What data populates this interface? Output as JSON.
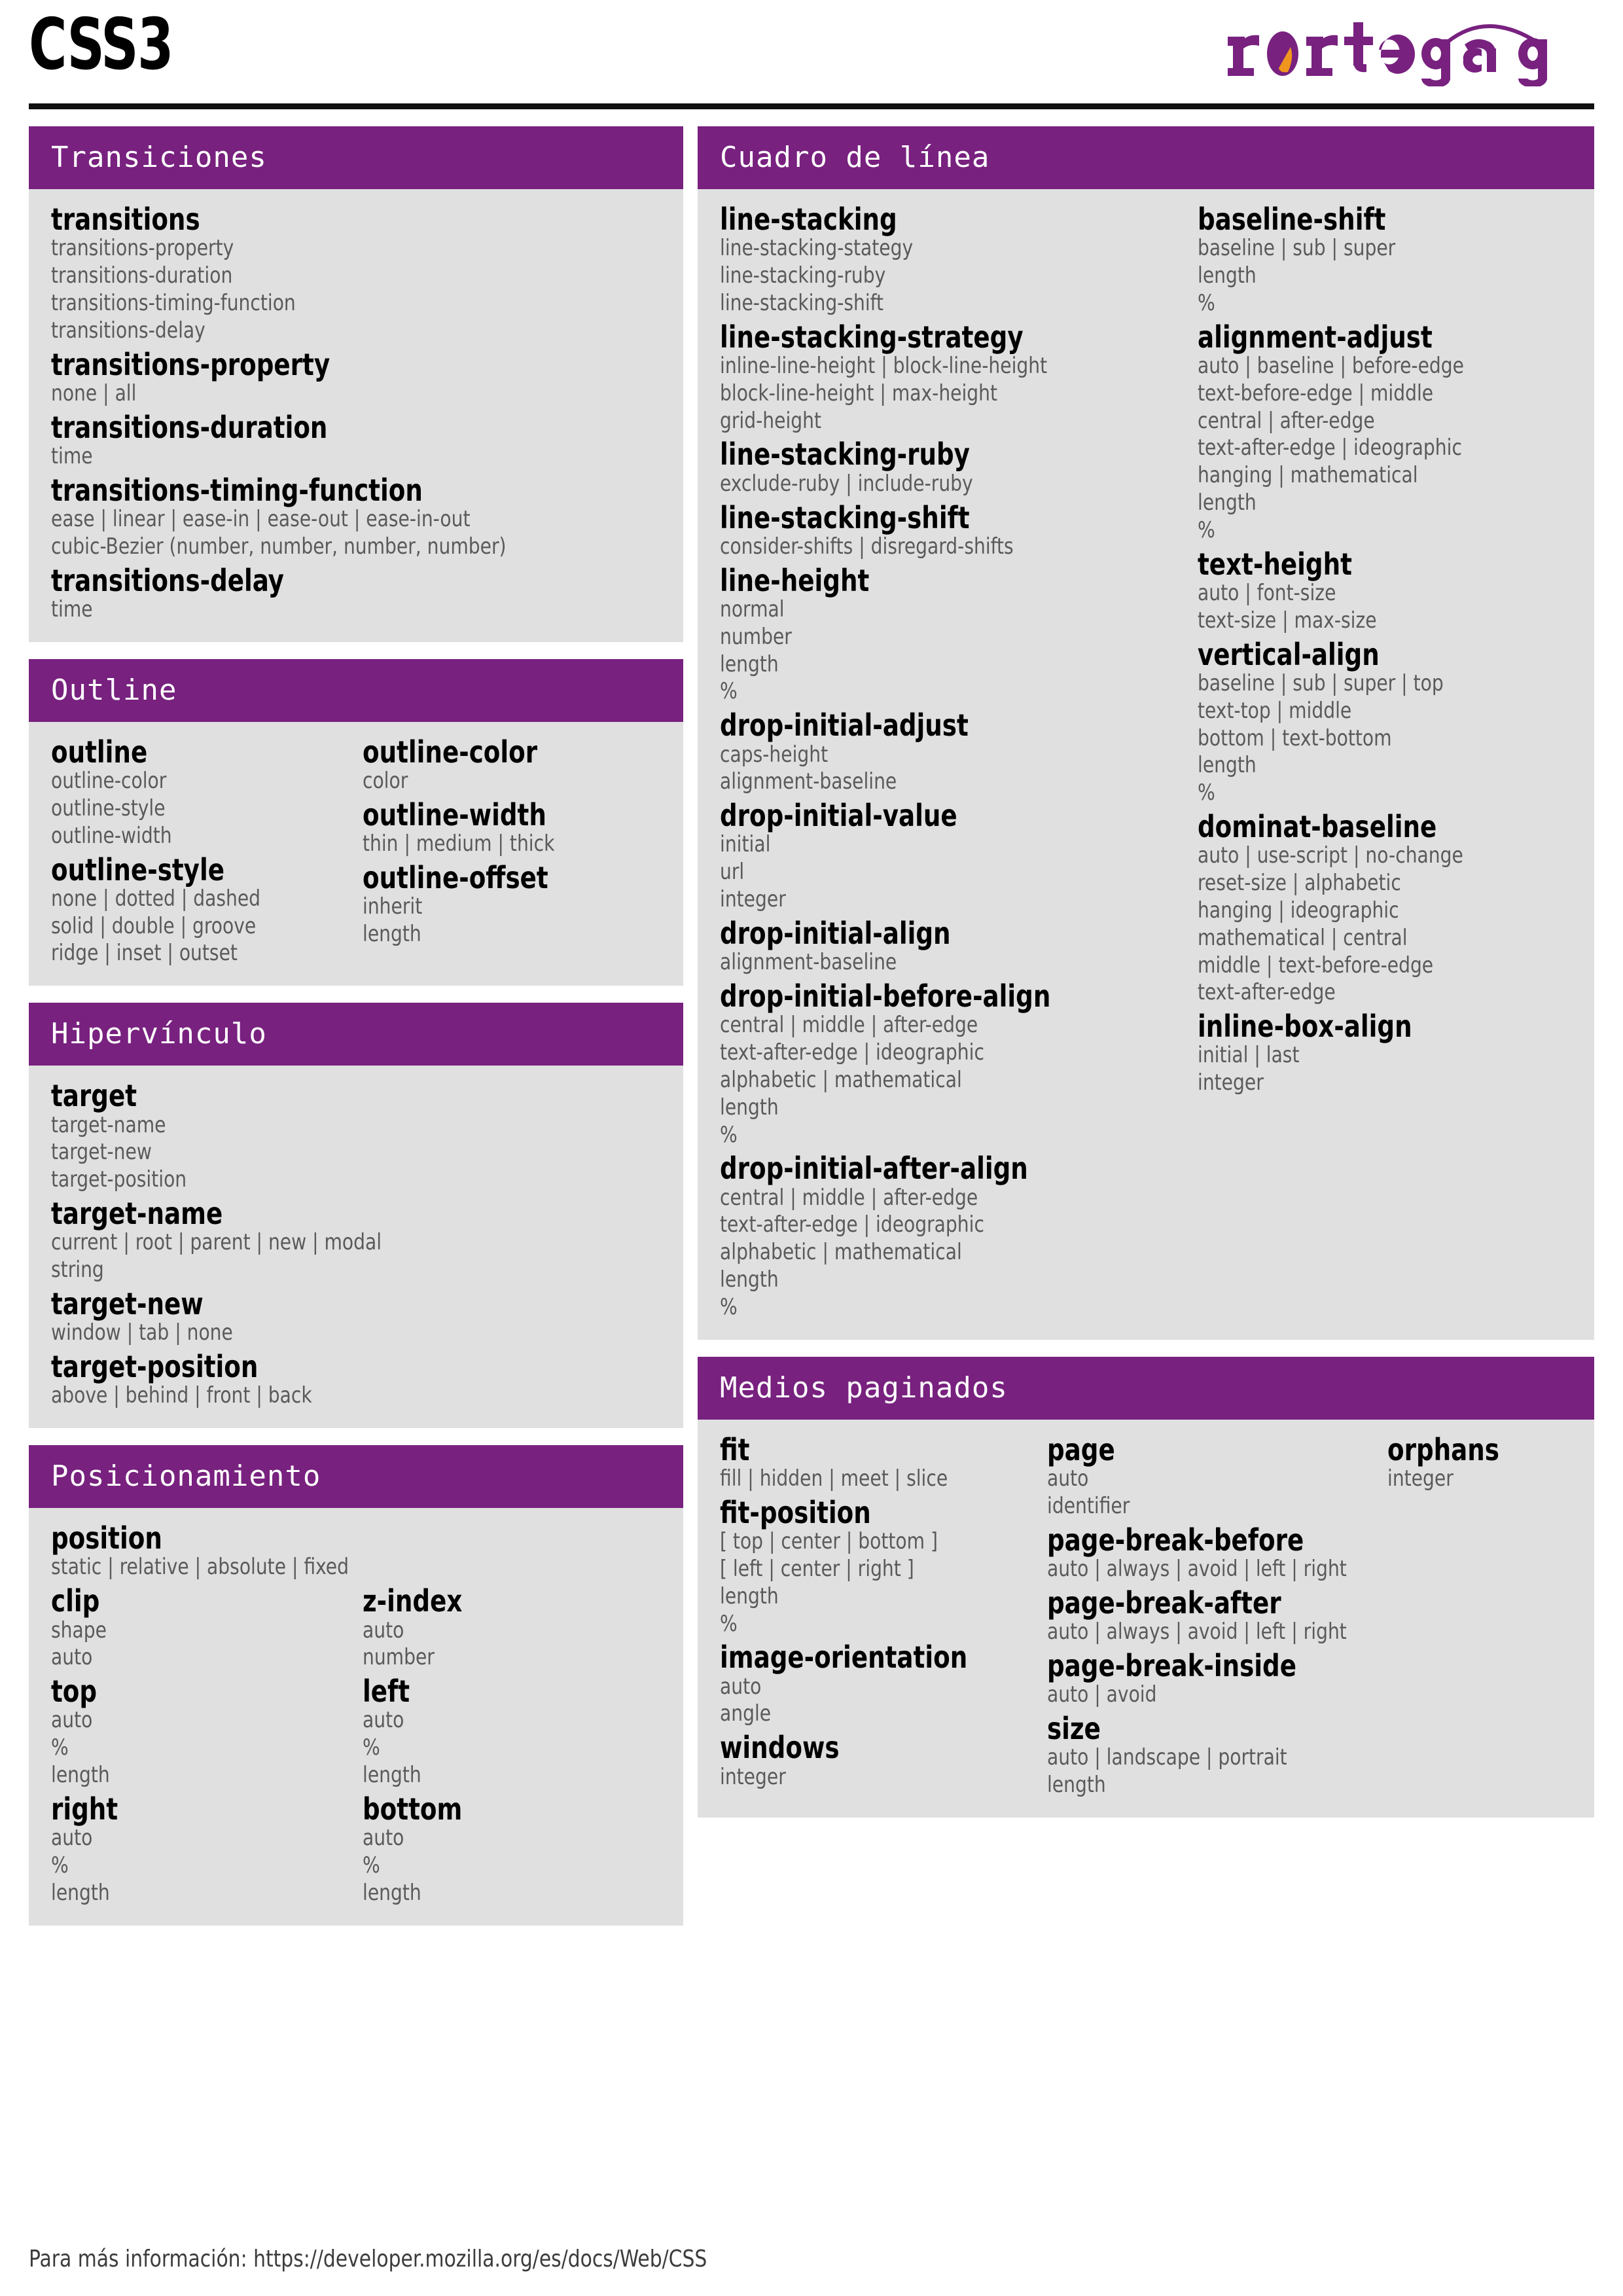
{
  "header": {
    "title": "CSS3",
    "logo_text": "rortegag",
    "logo_purple": "#78217f",
    "logo_orange": "#f0951e"
  },
  "theme": {
    "header_purple": "#78217f",
    "panel_gray": "#e0e0e0",
    "name_color": "#000000",
    "value_color": "#5a5a5a"
  },
  "footer": {
    "text": "Para más información: https://developer.mozilla.org/es/docs/Web/CSS"
  },
  "sections": {
    "transiciones": {
      "title": "Transiciones",
      "props": [
        {
          "name": "transitions",
          "values": [
            "transitions-property",
            "transitions-duration",
            "transitions-timing-function",
            "transitions-delay"
          ]
        },
        {
          "name": "transitions-property",
          "values": [
            "none | all"
          ]
        },
        {
          "name": "transitions-duration",
          "values": [
            "time"
          ]
        },
        {
          "name": "transitions-timing-function",
          "values": [
            "ease | linear | ease-in | ease-out | ease-in-out",
            "cubic-Bezier (number, number, number, number)"
          ]
        },
        {
          "name": "transitions-delay",
          "values": [
            "time"
          ]
        }
      ]
    },
    "outline": {
      "title": "Outline",
      "col_a": [
        {
          "name": "outline",
          "values": [
            "outline-color",
            "outline-style",
            "outline-width"
          ]
        },
        {
          "name": "outline-style",
          "values": [
            "none | dotted | dashed",
            "solid | double | groove",
            "ridge | inset | outset"
          ]
        }
      ],
      "col_b": [
        {
          "name": "outline-color",
          "values": [
            "color"
          ]
        },
        {
          "name": "outline-width",
          "values": [
            "thin | medium | thick"
          ]
        },
        {
          "name": "outline-offset",
          "values": [
            "inherit",
            "length"
          ]
        }
      ]
    },
    "hipervinculo": {
      "title": "Hipervínculo",
      "props": [
        {
          "name": "target",
          "values": [
            "target-name",
            "target-new",
            "target-position"
          ]
        },
        {
          "name": "target-name",
          "values": [
            "current | root | parent | new | modal",
            "string"
          ]
        },
        {
          "name": "target-new",
          "values": [
            "window | tab | none"
          ]
        },
        {
          "name": "target-position",
          "values": [
            "above | behind | front | back"
          ]
        }
      ]
    },
    "posicionamiento": {
      "title": "Posicionamiento",
      "full": [
        {
          "name": "position",
          "values": [
            "static | relative | absolute | fixed"
          ]
        }
      ],
      "col_a": [
        {
          "name": "clip",
          "values": [
            "shape",
            "auto"
          ]
        },
        {
          "name": "top",
          "values": [
            "auto",
            "%",
            "length"
          ]
        },
        {
          "name": "right",
          "values": [
            "auto",
            "%",
            "length"
          ]
        }
      ],
      "col_b": [
        {
          "name": "z-index",
          "values": [
            "auto",
            "number"
          ]
        },
        {
          "name": "left",
          "values": [
            "auto",
            "%",
            "length"
          ]
        },
        {
          "name": "bottom",
          "values": [
            "auto",
            "%",
            "length"
          ]
        }
      ]
    },
    "cuadro_de_linea": {
      "title": "Cuadro de línea",
      "col_a": [
        {
          "name": "line-stacking",
          "values": [
            "line-stacking-stategy",
            "line-stacking-ruby",
            "line-stacking-shift"
          ]
        },
        {
          "name": "line-stacking-strategy",
          "values": [
            "inline-line-height | block-line-height",
            "block-line-height | max-height",
            "grid-height"
          ]
        },
        {
          "name": "line-stacking-ruby",
          "values": [
            "exclude-ruby | include-ruby"
          ]
        },
        {
          "name": "line-stacking-shift",
          "values": [
            "consider-shifts | disregard-shifts"
          ]
        },
        {
          "name": "line-height",
          "values": [
            "normal",
            "number",
            "length",
            "%"
          ]
        },
        {
          "name": "drop-initial-adjust",
          "values": [
            "caps-height",
            "alignment-baseline"
          ]
        },
        {
          "name": "drop-initial-value",
          "values": [
            "initial",
            "url",
            "integer"
          ]
        },
        {
          "name": "drop-initial-align",
          "values": [
            "alignment-baseline"
          ]
        },
        {
          "name": "drop-initial-before-align",
          "values": [
            "central | middle | after-edge",
            "text-after-edge | ideographic",
            "alphabetic | mathematical",
            "length",
            "%"
          ]
        },
        {
          "name": "drop-initial-after-align",
          "values": [
            "central | middle | after-edge",
            "text-after-edge | ideographic",
            "alphabetic | mathematical",
            "length",
            "%"
          ]
        }
      ],
      "col_b": [
        {
          "name": "baseline-shift",
          "values": [
            "baseline | sub | super",
            "length",
            "%"
          ]
        },
        {
          "name": "alignment-adjust",
          "values": [
            "auto | baseline | before-edge",
            "text-before-edge | middle",
            "central | after-edge",
            "text-after-edge | ideographic",
            "hanging | mathematical",
            "length",
            "%"
          ]
        },
        {
          "name": "text-height",
          "values": [
            "auto | font-size",
            "text-size | max-size"
          ]
        },
        {
          "name": "vertical-align",
          "values": [
            "baseline | sub | super | top",
            "text-top | middle",
            "bottom | text-bottom",
            "length",
            "%"
          ]
        },
        {
          "name": "dominat-baseline",
          "values": [
            "auto | use-script | no-change",
            "reset-size | alphabetic",
            "hanging | ideographic",
            "mathematical | central",
            "middle | text-before-edge",
            "text-after-edge"
          ]
        },
        {
          "name": "inline-box-align",
          "values": [
            "initial | last",
            "integer"
          ]
        }
      ]
    },
    "medios_paginados": {
      "title": "Medios paginados",
      "col_a": [
        {
          "name": "fit",
          "values": [
            "fill | hidden | meet | slice"
          ]
        },
        {
          "name": "fit-position",
          "values": [
            "[ top | center | bottom ]",
            "[ left | center | right ]",
            "length",
            "%"
          ]
        },
        {
          "name": "image-orientation",
          "values": [
            "auto",
            "angle"
          ]
        },
        {
          "name": "windows",
          "values": [
            "integer"
          ]
        }
      ],
      "col_b": [
        {
          "name": "page",
          "values": [
            "auto",
            "identifier"
          ]
        },
        {
          "name": "page-break-before",
          "values": [
            "auto | always | avoid | left | right"
          ]
        },
        {
          "name": "page-break-after",
          "values": [
            "auto | always | avoid | left | right"
          ]
        },
        {
          "name": "page-break-inside",
          "values": [
            "auto | avoid"
          ]
        },
        {
          "name": "size",
          "values": [
            "auto | landscape | portrait",
            "length"
          ]
        }
      ],
      "col_c": [
        {
          "name": "orphans",
          "values": [
            "integer"
          ]
        }
      ]
    }
  }
}
